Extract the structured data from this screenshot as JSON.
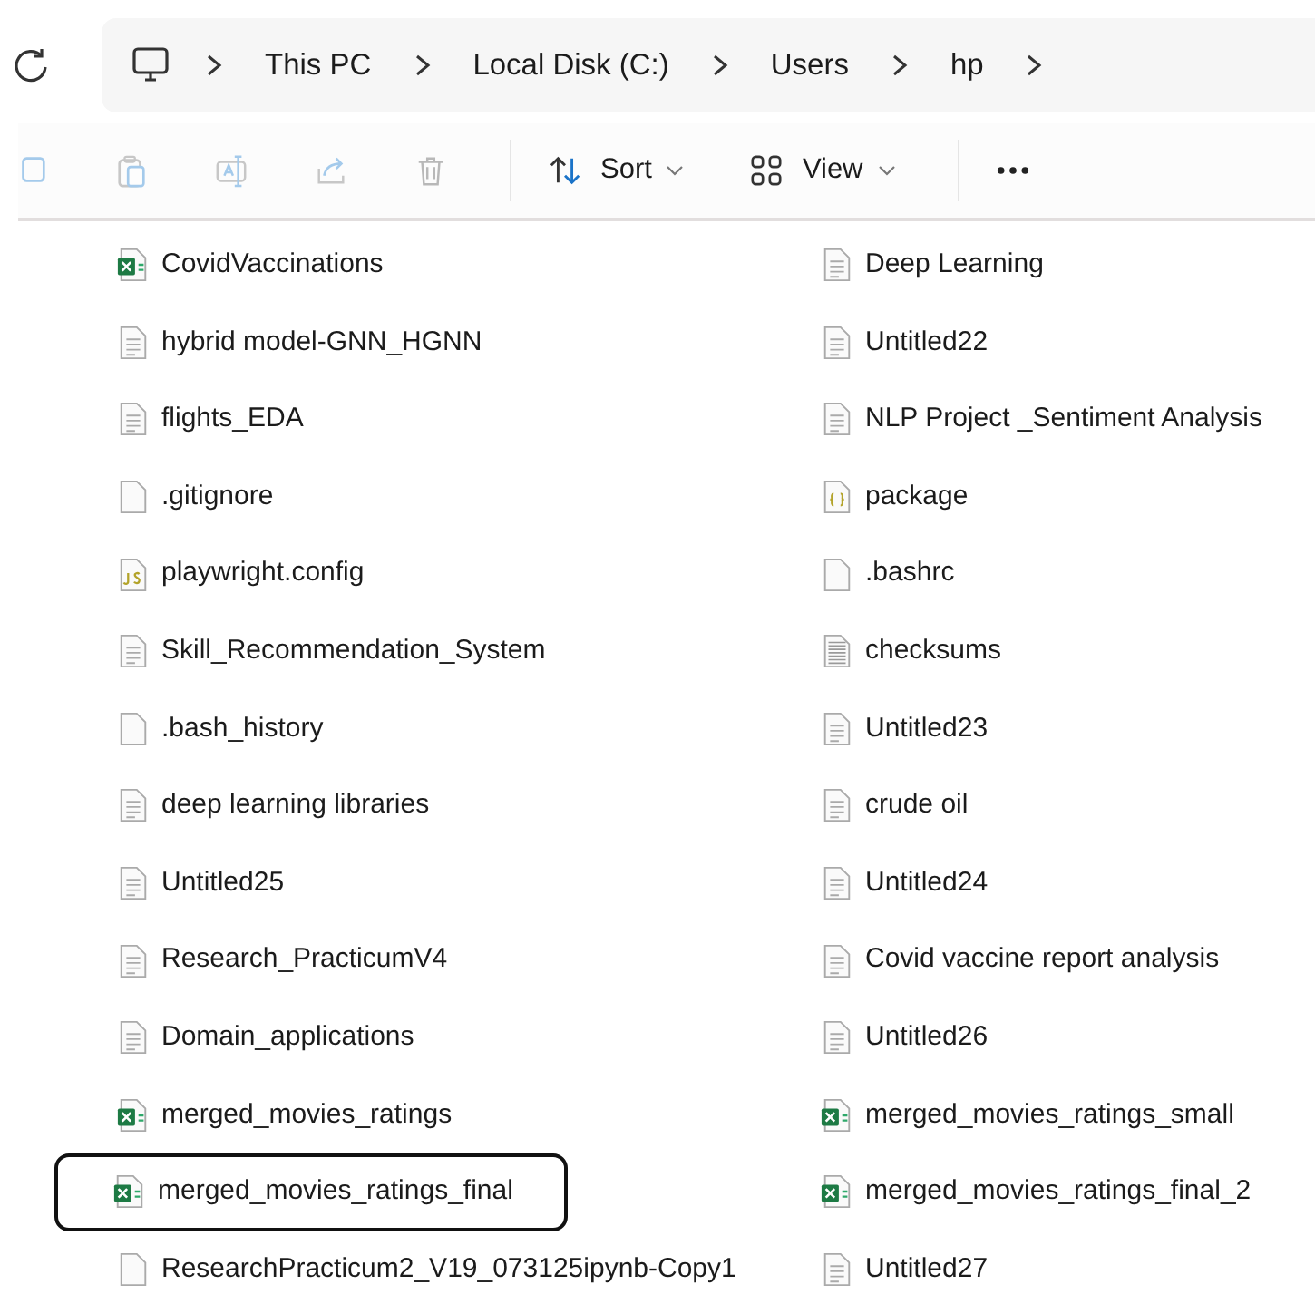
{
  "breadcrumb": {
    "segments": [
      "This PC",
      "Local Disk (C:)",
      "Users",
      "hp"
    ]
  },
  "toolbar": [
    {
      "kind": "copy",
      "disabled": true
    },
    {
      "kind": "paste",
      "disabled": true
    },
    {
      "kind": "rename",
      "disabled": true
    },
    {
      "kind": "share",
      "disabled": true
    },
    {
      "kind": "delete",
      "disabled": true
    },
    {
      "kind": "sort",
      "label": "Sort",
      "disabled": false
    },
    {
      "kind": "view",
      "label": "View",
      "disabled": false
    },
    {
      "kind": "more",
      "disabled": false
    }
  ],
  "columns": [
    [
      {
        "name": "CovidVaccinations",
        "kind": "excel",
        "selected": false
      },
      {
        "name": "hybrid model-GNN_HGNN",
        "kind": "doc",
        "selected": false
      },
      {
        "name": "flights_EDA",
        "kind": "doc",
        "selected": false
      },
      {
        "name": ".gitignore",
        "kind": "blank",
        "selected": false
      },
      {
        "name": "playwright.config",
        "kind": "js",
        "selected": false
      },
      {
        "name": "Skill_Recommendation_System",
        "kind": "doc",
        "selected": false
      },
      {
        "name": ".bash_history",
        "kind": "blank",
        "selected": false
      },
      {
        "name": "deep learning libraries",
        "kind": "doc",
        "selected": false
      },
      {
        "name": "Untitled25",
        "kind": "doc",
        "selected": false
      },
      {
        "name": "Research_PracticumV4",
        "kind": "doc",
        "selected": false
      },
      {
        "name": "Domain_applications",
        "kind": "doc",
        "selected": false
      },
      {
        "name": "merged_movies_ratings",
        "kind": "excel",
        "selected": false
      },
      {
        "name": "merged_movies_ratings_final",
        "kind": "excel",
        "selected": true
      },
      {
        "name": "ResearchPracticum2_V19_073125ipynb-Copy1",
        "kind": "blank",
        "selected": false
      }
    ],
    [
      {
        "name": "Deep Learning",
        "kind": "doc",
        "selected": false
      },
      {
        "name": "Untitled22",
        "kind": "doc",
        "selected": false
      },
      {
        "name": "NLP Project _Sentiment Analysis",
        "kind": "doc",
        "selected": false
      },
      {
        "name": "package",
        "kind": "json",
        "selected": false
      },
      {
        "name": ".bashrc",
        "kind": "blank",
        "selected": false
      },
      {
        "name": "checksums",
        "kind": "lines",
        "selected": false
      },
      {
        "name": "Untitled23",
        "kind": "doc",
        "selected": false
      },
      {
        "name": "crude oil",
        "kind": "doc",
        "selected": false
      },
      {
        "name": "Untitled24",
        "kind": "doc",
        "selected": false
      },
      {
        "name": "Covid vaccine report analysis",
        "kind": "doc",
        "selected": false
      },
      {
        "name": "Untitled26",
        "kind": "doc",
        "selected": false
      },
      {
        "name": "merged_movies_ratings_small",
        "kind": "excel",
        "selected": false
      },
      {
        "name": "merged_movies_ratings_final_2",
        "kind": "excel",
        "selected": false
      },
      {
        "name": "Untitled27",
        "kind": "doc",
        "selected": false
      }
    ]
  ]
}
